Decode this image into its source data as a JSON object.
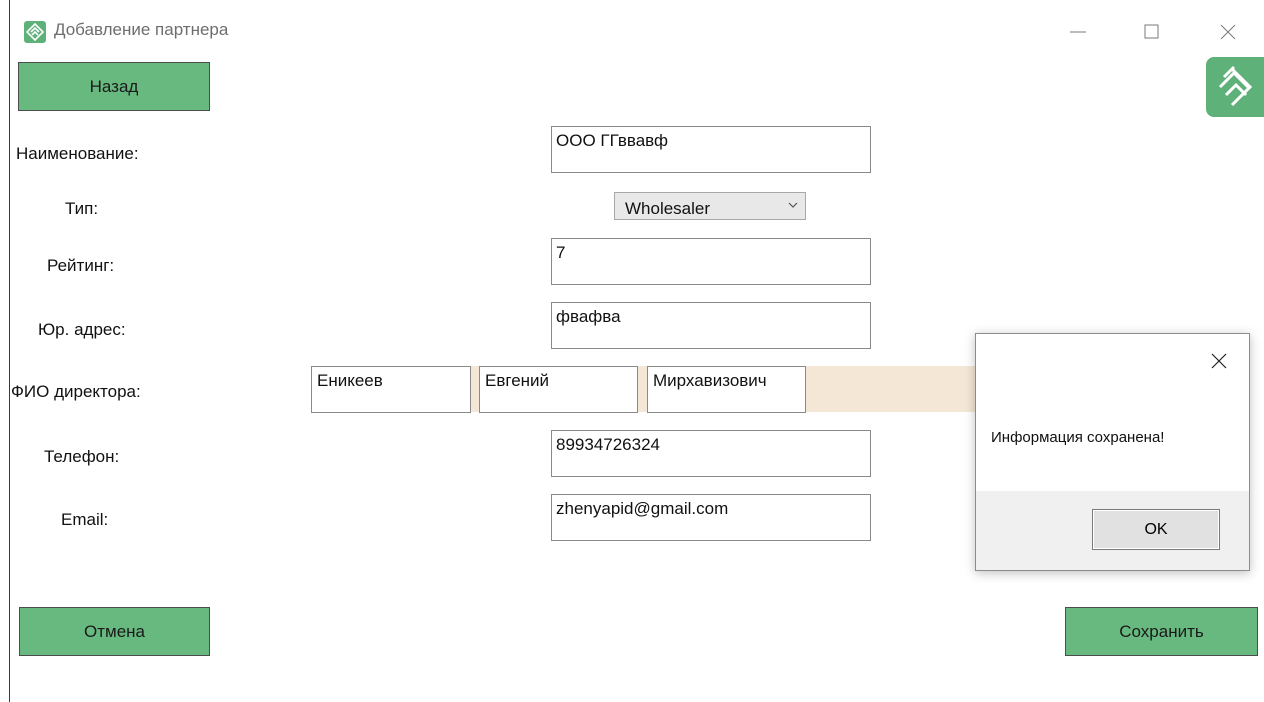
{
  "window": {
    "title": "Добавление партнера"
  },
  "buttons": {
    "back": "Назад",
    "cancel": "Отмена",
    "save": "Сохранить"
  },
  "form": {
    "name_label": "Наименование:",
    "name_value": "ООО ГГввавф",
    "type_label": "Тип:",
    "type_value": "Wholesaler",
    "rating_label": "Рейтинг:",
    "rating_value": "7",
    "address_label": "Юр. адрес:",
    "address_value": "фвафва",
    "director_label": "ФИО директора:",
    "director_last": "Еникеев",
    "director_first": "Евгений",
    "director_middle": "Мирхавизович",
    "phone_label": "Телефон:",
    "phone_value": "89934726324",
    "email_label": "Email:",
    "email_value": "zhenyapid@gmail.com"
  },
  "dialog": {
    "message": "Информация сохранена!",
    "ok": "OK"
  },
  "colors": {
    "accent_green": "#67b97f",
    "logo_green": "#5fb17a",
    "fio_band": "#f4e7d5"
  }
}
